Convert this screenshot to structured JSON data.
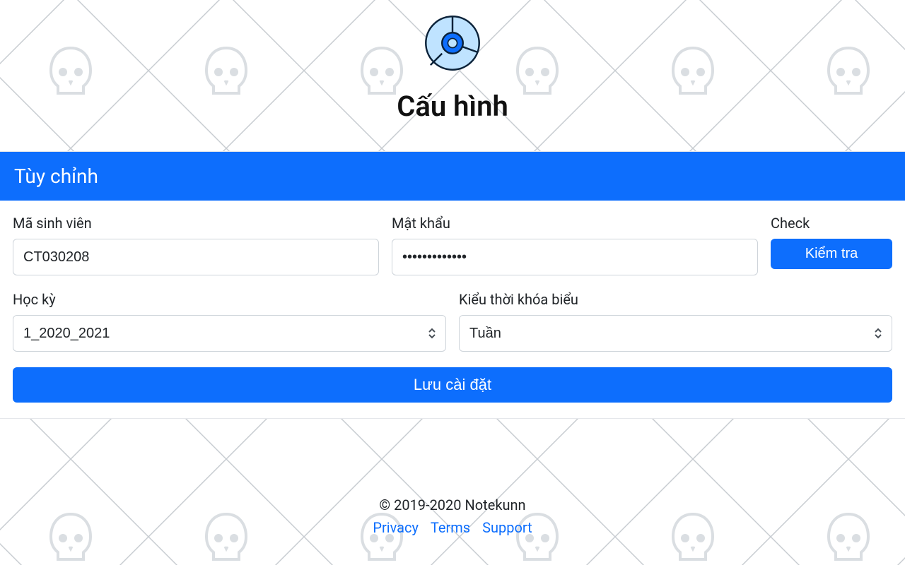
{
  "header": {
    "title": "Cấu hình"
  },
  "card": {
    "section_title": "Tùy chỉnh",
    "fields": {
      "student_id": {
        "label": "Mã sinh viên",
        "value": "CT030208"
      },
      "password": {
        "label": "Mật khẩu",
        "value": "••••••••••••"
      },
      "check": {
        "label": "Check",
        "button": "Kiểm tra"
      },
      "semester": {
        "label": "Học kỳ",
        "value": "1_2020_2021"
      },
      "schedule_type": {
        "label": "Kiểu thời khóa biểu",
        "value": "Tuần"
      }
    },
    "save_button": "Lưu cài đặt"
  },
  "footer": {
    "copyright": "© 2019-2020 Notekunn",
    "links": [
      "Privacy",
      "Terms",
      "Support"
    ]
  }
}
